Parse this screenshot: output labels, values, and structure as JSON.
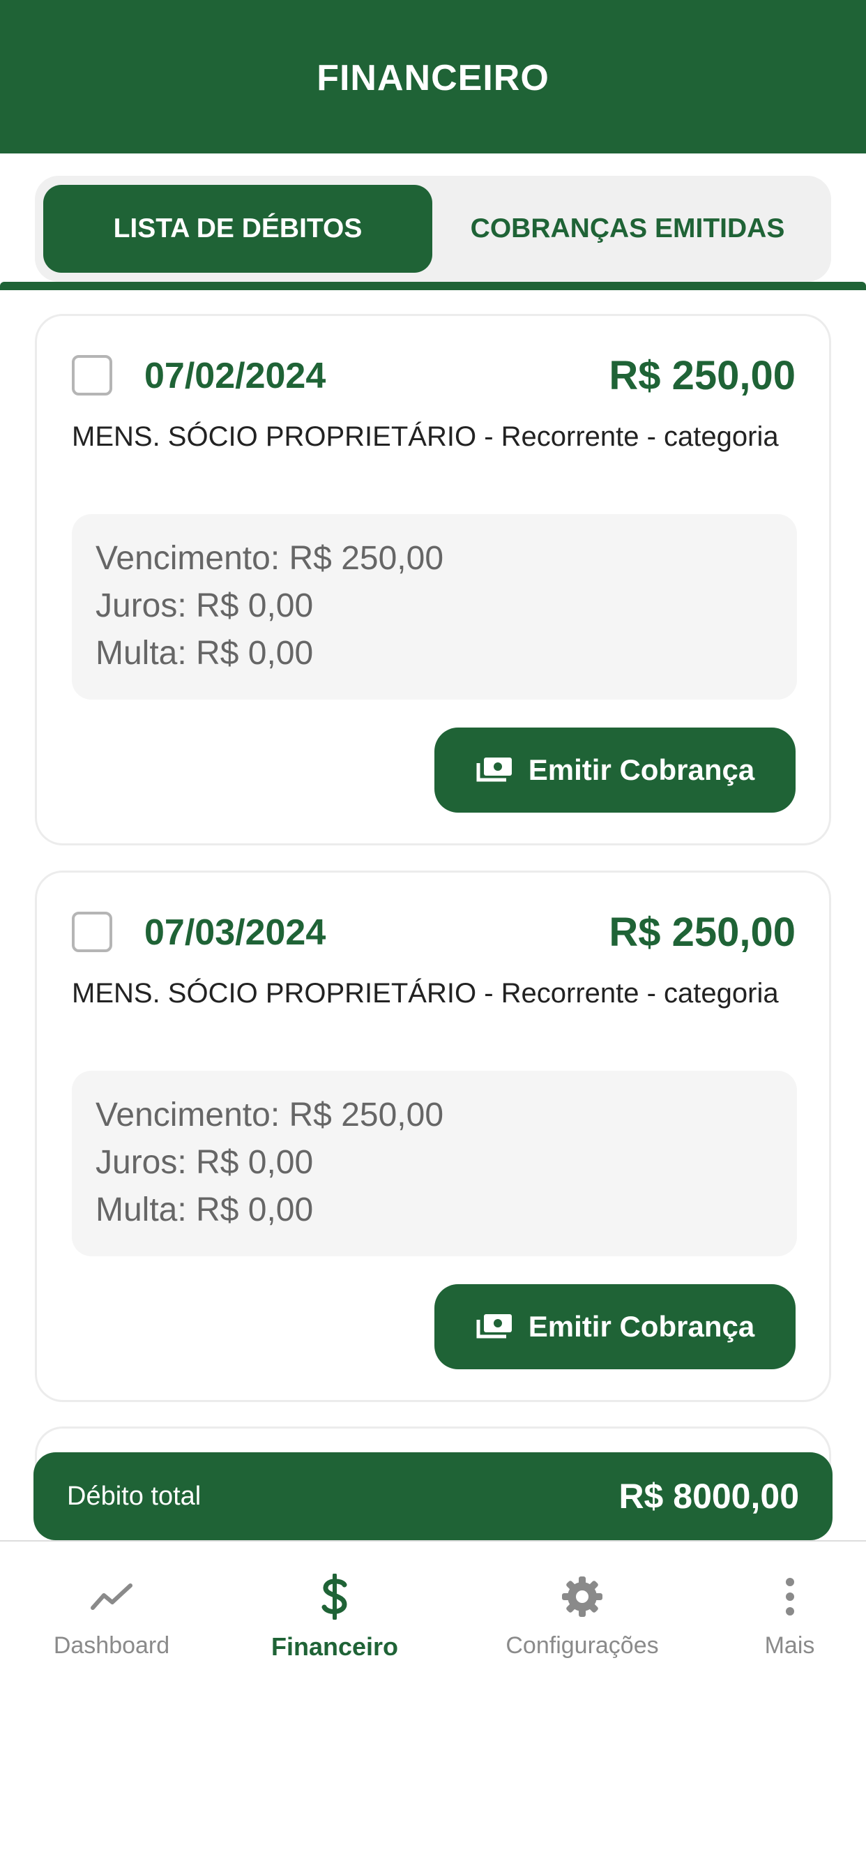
{
  "header": {
    "title": "FINANCEIRO"
  },
  "tabs": [
    {
      "label": "LISTA DE DÉBITOS",
      "active": true
    },
    {
      "label": "COBRANÇAS EMITIDAS",
      "active": false
    }
  ],
  "debits": [
    {
      "date": "07/02/2024",
      "amount": "R$ 250,00",
      "description": "MENS. SÓCIO PROPRIETÁRIO - Recorrente - categoria",
      "due": "Vencimento: R$ 250,00",
      "interest": "Juros: R$ 0,00",
      "fine": "Multa: R$ 0,00",
      "action_label": "Emitir Cobrança",
      "checked": false
    },
    {
      "date": "07/03/2024",
      "amount": "R$ 250,00",
      "description": "MENS. SÓCIO PROPRIETÁRIO - Recorrente - categoria",
      "due": "Vencimento: R$ 250,00",
      "interest": "Juros: R$ 0,00",
      "fine": "Multa: R$ 0,00",
      "action_label": "Emitir Cobrança",
      "checked": false
    }
  ],
  "total": {
    "label": "Débito total",
    "value": "R$ 8000,00"
  },
  "nav": [
    {
      "label": "Dashboard",
      "icon": "chart-line-icon",
      "active": false
    },
    {
      "label": "Financeiro",
      "icon": "dollar-icon",
      "active": true
    },
    {
      "label": "Configurações",
      "icon": "gear-icon",
      "active": false
    },
    {
      "label": "Mais",
      "icon": "more-vertical-icon",
      "active": false
    }
  ],
  "colors": {
    "primary": "#1f6336",
    "background": "#ffffff",
    "detail_background": "#f5f5f5",
    "inactive_text": "#8a8a8a"
  }
}
